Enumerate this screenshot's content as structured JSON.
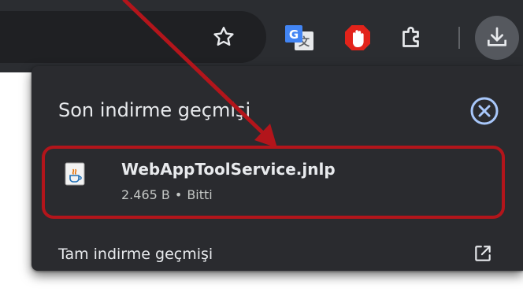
{
  "toolbar": {
    "icons": [
      "star-icon",
      "google-translate-icon",
      "stop-hand-icon",
      "puzzle-extensions-icon",
      "download-icon"
    ]
  },
  "download_bubble": {
    "title": "Son indirme geçmişi",
    "items": [
      {
        "file_name": "WebAppToolService.jnlp",
        "size": "2.465 B",
        "separator": "•",
        "status": "Bitti",
        "icon": "java-file-icon"
      }
    ],
    "full_history_label": "Tam indirme geçmişi",
    "close_icon": "close-circle-icon",
    "open_icon": "open-in-new-icon"
  },
  "annotation": {
    "color": "#b3151b"
  }
}
